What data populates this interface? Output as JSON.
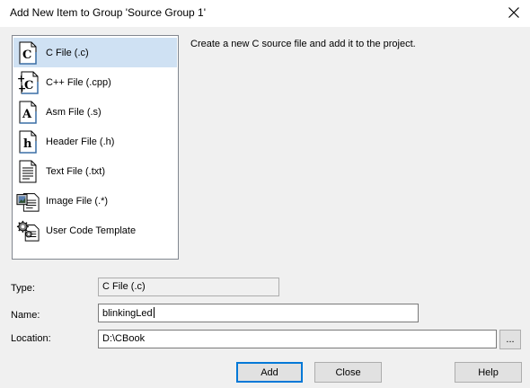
{
  "window": {
    "title": "Add New Item to Group 'Source Group 1'",
    "close_icon": "close-icon"
  },
  "file_types": {
    "items": [
      {
        "label": "C File (.c)",
        "icon": "c-file-icon",
        "selected": true
      },
      {
        "label": "C++ File (.cpp)",
        "icon": "cpp-file-icon",
        "selected": false
      },
      {
        "label": "Asm File (.s)",
        "icon": "asm-file-icon",
        "selected": false
      },
      {
        "label": "Header File (.h)",
        "icon": "header-file-icon",
        "selected": false
      },
      {
        "label": "Text File (.txt)",
        "icon": "text-file-icon",
        "selected": false
      },
      {
        "label": "Image File (.*)",
        "icon": "image-file-icon",
        "selected": false
      },
      {
        "label": "User Code Template",
        "icon": "user-code-template-icon",
        "selected": false
      }
    ]
  },
  "description": "Create a new C source file and add it to the project.",
  "form": {
    "type_label": "Type:",
    "type_value": "C File (.c)",
    "name_label": "Name:",
    "name_value": "blinkingLed",
    "location_label": "Location:",
    "location_value": "D:\\CBook",
    "browse_label": "..."
  },
  "buttons": {
    "add": "Add",
    "close": "Close",
    "help": "Help"
  },
  "colors": {
    "selection": "#cfe1f3",
    "default_button_border": "#0078d7"
  }
}
